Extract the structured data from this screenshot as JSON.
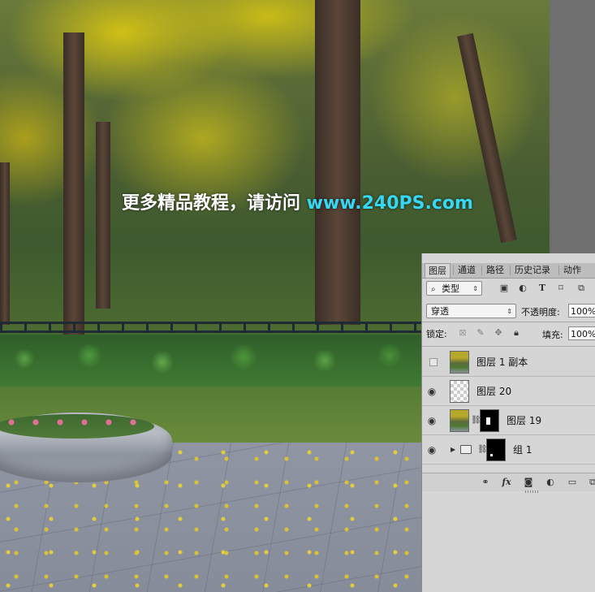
{
  "watermark": {
    "text": "更多精品教程，请访问 ",
    "url": "www.240PS.com"
  },
  "layers_panel": {
    "tabs": [
      {
        "label": "图层",
        "active": true
      },
      {
        "label": "通道",
        "active": false
      },
      {
        "label": "路径",
        "active": false
      },
      {
        "label": "历史记录",
        "active": false
      },
      {
        "label": "动作",
        "active": false
      }
    ],
    "filter": {
      "icon": "search-icon",
      "value": "类型"
    },
    "filter_icons": [
      "image-filter-icon",
      "adjustment-filter-icon",
      "type-filter-icon",
      "shape-filter-icon",
      "smart-object-filter-icon"
    ],
    "blend_mode": "穿透",
    "opacity_label": "不透明度:",
    "opacity_value": "100%",
    "lock_label": "锁定:",
    "lock_icons": [
      "lock-transparent-icon",
      "lock-paint-icon",
      "lock-position-icon",
      "lock-all-icon"
    ],
    "fill_label": "填充:",
    "fill_value": "100%",
    "layers": [
      {
        "name": "图层 1 副本",
        "visible": false,
        "thumb": "photo"
      },
      {
        "name": "图层 20",
        "visible": true,
        "thumb": "transparent"
      },
      {
        "name": "图层 19",
        "visible": true,
        "thumb": "photo",
        "mask": true
      },
      {
        "name": "组 1",
        "visible": true,
        "thumb": "group",
        "mask": true
      }
    ],
    "bottom_icons": [
      "link-icon",
      "fx-icon",
      "add-mask-icon",
      "adjustment-icon",
      "new-group-icon",
      "new-layer-icon"
    ],
    "fx_label": "fx"
  }
}
